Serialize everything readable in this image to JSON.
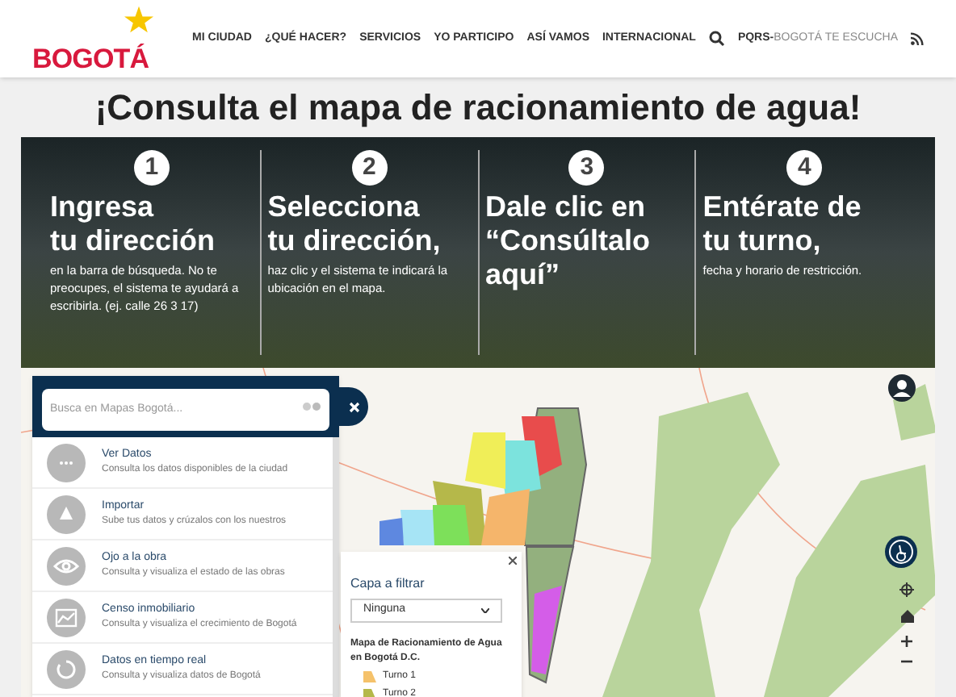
{
  "header": {
    "logo": "BOGOTÁ",
    "nav": [
      "MI CIUDAD",
      "¿QUÉ HACER?",
      "SERVICIOS",
      "YO PARTICIPO",
      "ASÍ VAMOS",
      "INTERNACIONAL"
    ],
    "pqrs_prefix": "PQRS-",
    "pqrs": "BOGOTÁ TE ESCUCHA"
  },
  "title": "¡Consulta el mapa de racionamiento de agua!",
  "steps": [
    {
      "number": "1",
      "heading_lines": [
        "Ingresa",
        "tu dirección"
      ],
      "text": "en la barra de búsqueda. No te preocupes, el sistema te ayudará a escribirla. (ej. calle 26 3 17)"
    },
    {
      "number": "2",
      "heading_lines": [
        "Selecciona",
        "tu dirección,"
      ],
      "text": "haz clic y el sistema te indicará la ubicación en el mapa."
    },
    {
      "number": "3",
      "heading_lines": [
        "Dale clic en",
        "“Consúltalo",
        "aquí”"
      ]
    },
    {
      "number": "4",
      "heading_lines": [
        "Entérate de",
        "tu turno,"
      ],
      "text": "fecha y horario de restricción."
    }
  ],
  "search": {
    "placeholder": "Busca en Mapas Bogotá..."
  },
  "menu": [
    {
      "kind": "data",
      "title": "Ver Datos",
      "subtitle": "Consulta los datos disponibles de la ciudad"
    },
    {
      "kind": "import",
      "title": "Importar",
      "subtitle": "Sube tus datos y crúzalos con los nuestros"
    },
    {
      "kind": "eye",
      "title": "Ojo a la obra",
      "subtitle": "Consulta y visualiza el estado de las obras"
    },
    {
      "kind": "census",
      "title": "Censo inmobiliario",
      "subtitle": "Consulta y visualiza el crecimiento de Bogotá"
    },
    {
      "kind": "realtime",
      "title": "Datos en tiempo real",
      "subtitle": "Consulta y visualiza datos de Bogotá"
    }
  ],
  "filter": {
    "label": "Capa a filtrar",
    "value": "Ninguna",
    "legend_title": "Mapa de Racionamiento de Agua en Bogotá D.C.",
    "legend": [
      {
        "label": "Turno 1",
        "color": "#f5c26b"
      },
      {
        "label": "Turno 2",
        "color": "#b5b84a"
      }
    ]
  }
}
